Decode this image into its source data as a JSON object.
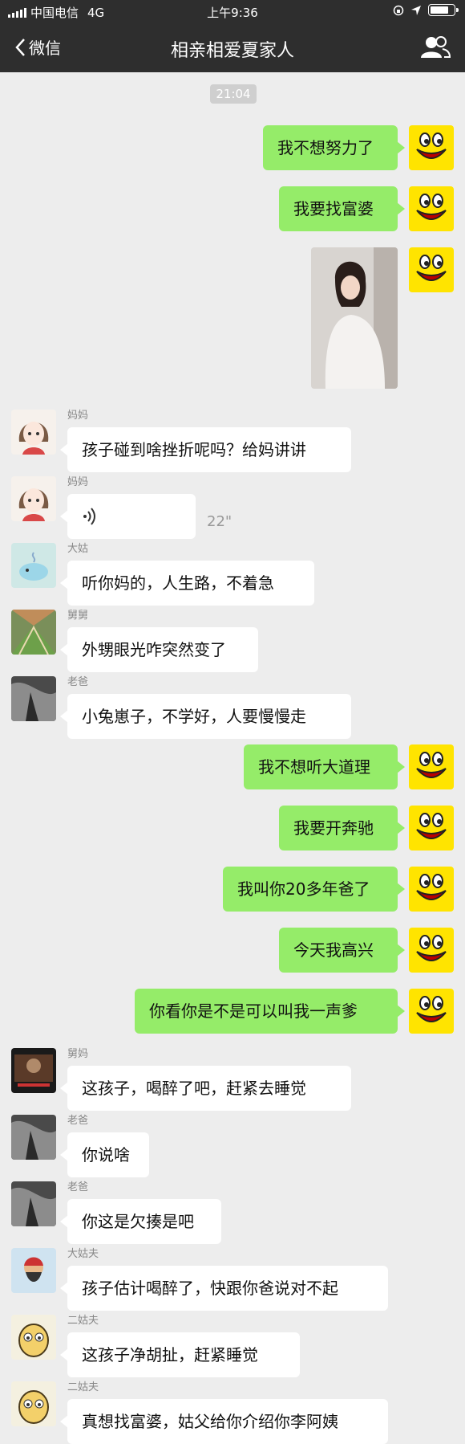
{
  "status_bar": {
    "carrier": "中国电信",
    "network": "4G",
    "time": "上午9:36"
  },
  "nav": {
    "back_label": "微信",
    "title": "相亲相爱夏家人"
  },
  "chat": {
    "timestamp": "21:04",
    "messages": [
      {
        "side": "right",
        "type": "text",
        "text": "我不想努力了"
      },
      {
        "side": "right",
        "type": "text",
        "text": "我要找富婆"
      },
      {
        "side": "right",
        "type": "image"
      },
      {
        "side": "left",
        "type": "text",
        "sender": "妈妈",
        "text": "孩子碰到啥挫折呢吗？给妈讲讲"
      },
      {
        "side": "left",
        "type": "voice",
        "sender": "妈妈",
        "duration": "22\""
      },
      {
        "side": "left",
        "type": "text",
        "sender": "大姑",
        "text": "听你妈的，人生路，不着急"
      },
      {
        "side": "left",
        "type": "text",
        "sender": "舅舅",
        "text": "外甥眼光咋突然变了"
      },
      {
        "side": "left",
        "type": "text",
        "sender": "老爸",
        "text": "小兔崽子，不学好，人要慢慢走"
      },
      {
        "side": "right",
        "type": "text",
        "text": "我不想听大道理"
      },
      {
        "side": "right",
        "type": "text",
        "text": "我要开奔驰"
      },
      {
        "side": "right",
        "type": "text",
        "text": "我叫你20多年爸了"
      },
      {
        "side": "right",
        "type": "text",
        "text": "今天我高兴"
      },
      {
        "side": "right",
        "type": "text",
        "text": "你看你是不是可以叫我一声爹"
      },
      {
        "side": "left",
        "type": "text",
        "sender": "舅妈",
        "text": "这孩子，喝醉了吧，赶紧去睡觉"
      },
      {
        "side": "left",
        "type": "text",
        "sender": "老爸",
        "text": "你说啥"
      },
      {
        "side": "left",
        "type": "text",
        "sender": "老爸",
        "text": "你这是欠揍是吧"
      },
      {
        "side": "left",
        "type": "text",
        "sender": "大姑夫",
        "text": "孩子估计喝醉了，快跟你爸说对不起"
      },
      {
        "side": "left",
        "type": "text",
        "sender": "二姑夫",
        "text": "这孩子净胡扯，赶紧睡觉"
      },
      {
        "side": "left",
        "type": "text",
        "sender": "二姑夫",
        "text": "真想找富婆，姑父给你介绍你李阿姨"
      }
    ]
  },
  "colors": {
    "header_bg": "#2e2e2e",
    "chat_bg": "#ededed",
    "my_bubble": "#95ec69",
    "other_bubble": "#ffffff"
  },
  "icons": [
    "back-chevron-icon",
    "group-members-icon",
    "smiley-avatar-icon",
    "voice-wave-icon"
  ]
}
